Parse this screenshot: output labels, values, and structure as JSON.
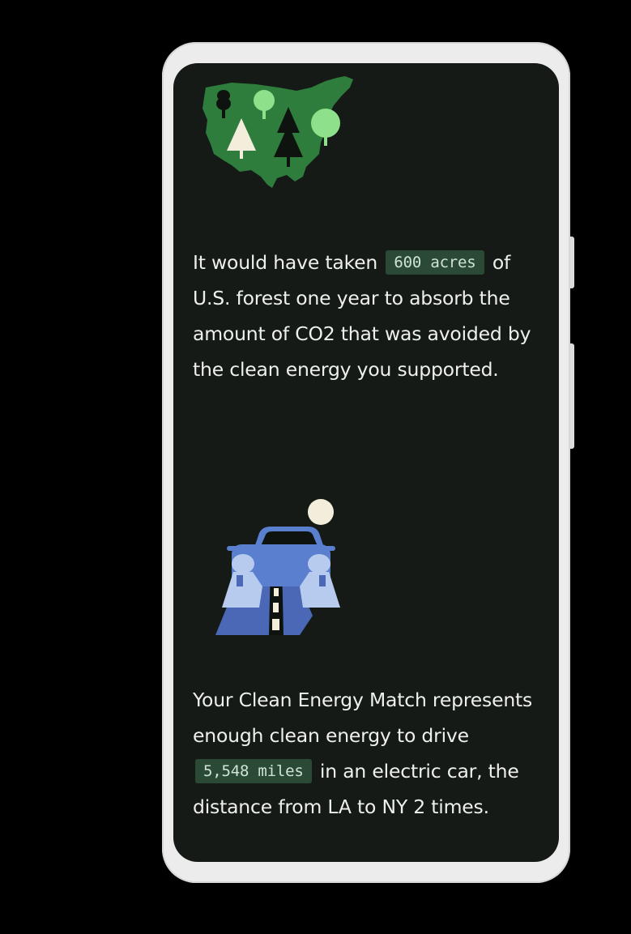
{
  "forest_fact": {
    "text_before": "It would have taken",
    "highlight": "600 acres",
    "text_after": "of U.S. forest one year to absorb the amount of CO2 that was avoided by the clean energy you supported."
  },
  "drive_fact": {
    "text_before": "Your Clean Energy Match represents enough clean energy to drive",
    "highlight": "5,548 miles",
    "text_after": "in an electric car, the distance from LA to NY 2 times."
  },
  "colors": {
    "screen_background": "#151a16",
    "highlight_chip": "#2b4a36",
    "map_green": "#2e7d3c",
    "car_blue": "#5b7fcf"
  },
  "icons": {
    "forest_illustration": "us-map-forest-icon",
    "car_illustration": "electric-car-road-icon"
  }
}
